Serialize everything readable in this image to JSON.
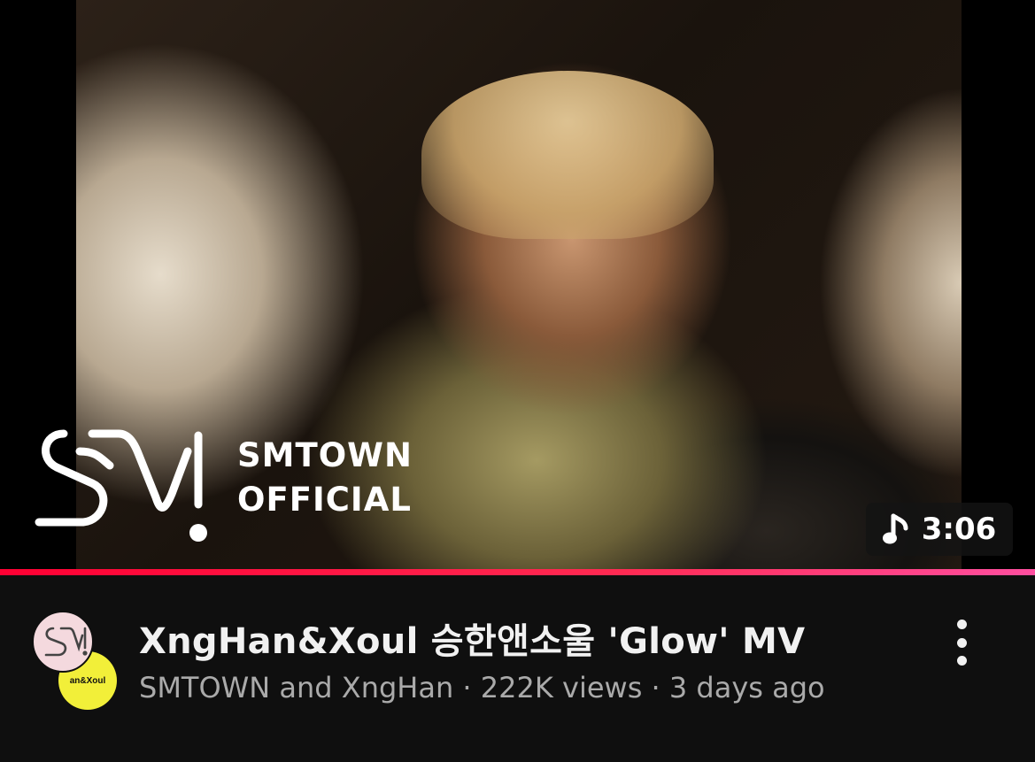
{
  "video": {
    "title": "XngHan&Xoul 승한앤소울 'Glow' MV",
    "channels": "SMTOWN and XngHan",
    "views": "222K views",
    "age": "3 days ago",
    "separator": "·",
    "duration": "3:06",
    "progress_percent": 100
  },
  "thumbnail": {
    "logo_line1": "SMTOWN",
    "logo_line2": "OFFICIAL",
    "logo_text": "SM!",
    "logo_icon": "sm-logo-icon"
  },
  "avatars": {
    "secondary_label": "an&Xoul"
  },
  "icons": {
    "duration": "music-note-icon",
    "menu": "more-vert-icon"
  },
  "colors": {
    "progress": "#ff0033",
    "background": "#0f0f0f",
    "avatar_secondary": "#f2ef39",
    "avatar_primary": "#f4d9de"
  }
}
